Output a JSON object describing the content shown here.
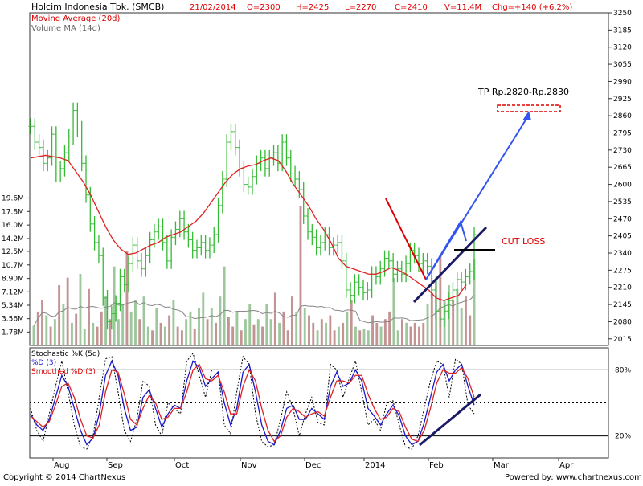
{
  "header": {
    "company": "Holcim Indonesia Tbk. (SMCB)",
    "date": "21/02/2014",
    "open": "O=2300",
    "high": "H=2425",
    "low": "L=2270",
    "close": "C=2410",
    "volume": "V=11.4M",
    "change": "Chg=+140 (+6.2%)"
  },
  "legend": {
    "ma20": "Moving Average (20d)",
    "volma": "Volume MA (14d)",
    "stoch_title": "Stochastic %K (5d)",
    "stoch_d": "%D (3)",
    "stoch_sd": "Smoothed %D (3)"
  },
  "annotations": {
    "tp": "TP Rp.2820-Rp.2830",
    "cutloss": "CUT LOSS"
  },
  "footer": {
    "copyright": "Copyright © 2014 ChartNexus",
    "powered": "Powered by: www.chartnexus.com"
  },
  "colors": {
    "background": "#ffffff",
    "price_bar": "#33bb33",
    "moving_average": "#dd2222",
    "volume_up": "#9ec79e",
    "volume_down": "#c49494",
    "volume_ma": "#888888",
    "stoch_k": "#000000",
    "stoch_d": "#1a1acc",
    "stoch_sd": "#dd2222",
    "trend_line": "#1a1a66",
    "cut_loss_line": "#000000",
    "annotation_red": "#dd0000",
    "annotation_blue": "#3355ee"
  },
  "chart_data": {
    "type": "line",
    "price": {
      "ylim": [
        1990,
        3250
      ],
      "y_ticks": [
        2015,
        2080,
        2145,
        2210,
        2275,
        2340,
        2405,
        2470,
        2535,
        2600,
        2665,
        2730,
        2795,
        2860,
        2925,
        2990,
        3055,
        3120,
        3185,
        3250
      ],
      "close": [
        2820,
        2760,
        2740,
        2680,
        2700,
        2790,
        2640,
        2660,
        2720,
        2780,
        2880,
        2810,
        2680,
        2560,
        2450,
        2380,
        2330,
        2170,
        2080,
        2110,
        2150,
        2250,
        2220,
        2300,
        2370,
        2310,
        2280,
        2330,
        2390,
        2420,
        2440,
        2380,
        2310,
        2400,
        2430,
        2470,
        2420,
        2390,
        2350,
        2360,
        2380,
        2350,
        2370,
        2410,
        2520,
        2620,
        2760,
        2800,
        2740,
        2660,
        2600,
        2590,
        2630,
        2680,
        2700,
        2660,
        2700,
        2720,
        2680,
        2760,
        2700,
        2640,
        2620,
        2580,
        2480,
        2420,
        2400,
        2360,
        2380,
        2410,
        2360,
        2370,
        2380,
        2310,
        2200,
        2180,
        2230,
        2210,
        2190,
        2200,
        2260,
        2250,
        2280,
        2320,
        2310,
        2260,
        2280,
        2260,
        2300,
        2350,
        2330,
        2300,
        2310,
        2290,
        2200,
        2120,
        2090,
        2120,
        2160,
        2200,
        2240,
        2230,
        2250,
        2270,
        2410
      ],
      "ma20": [
        2700,
        2705,
        2710,
        2705,
        2700,
        2690,
        2650,
        2610,
        2560,
        2500,
        2440,
        2390,
        2355,
        2335,
        2340,
        2355,
        2370,
        2380,
        2400,
        2410,
        2420,
        2440,
        2460,
        2490,
        2530,
        2570,
        2610,
        2640,
        2660,
        2670,
        2675,
        2690,
        2700,
        2690,
        2650,
        2600,
        2560,
        2520,
        2470,
        2430,
        2380,
        2320,
        2290,
        2280,
        2270,
        2260,
        2260,
        2270,
        2285,
        2275,
        2260,
        2240,
        2220,
        2200,
        2170,
        2160,
        2170,
        2180,
        2220
      ],
      "ma20_x_start_index": 0
    },
    "volume": {
      "y_ticks": [
        "1.78M",
        "3.56M",
        "5.34M",
        "7.12M",
        "8.90M",
        "10.7M",
        "12.5M",
        "14.2M",
        "16.0M",
        "17.8M",
        "19.6M"
      ],
      "ylim_m": [
        0,
        20.5
      ],
      "values_m": [
        2.6,
        4.5,
        6.0,
        4.0,
        2.5,
        3.5,
        8.0,
        5.5,
        9.0,
        3.0,
        4.2,
        9.5,
        2.2,
        7.5,
        3.0,
        2.5,
        4.5,
        6.5,
        3.5,
        10.5,
        3.5,
        5.5,
        12.5,
        4.5,
        6.0,
        3.5,
        6.5,
        2.5,
        2.0,
        5.0,
        3.0,
        2.5,
        4.0,
        6.0,
        2.5,
        2.0,
        3.5,
        4.5,
        2.2,
        5.0,
        7.0,
        3.5,
        5.0,
        3.0,
        6.5,
        10.5,
        3.8,
        2.5,
        4.5,
        2.0,
        3.5,
        5.5,
        2.8,
        3.5,
        2.5,
        5.5,
        3.5,
        7.0,
        3.0,
        4.5,
        2.0,
        6.5,
        4.5,
        18.5,
        5.0,
        4.0,
        3.0,
        2.0,
        3.5,
        3.0,
        4.0,
        2.0,
        2.5,
        3.0,
        4.5,
        6.0,
        2.5,
        2.0,
        2.2,
        2.0,
        4.0,
        3.0,
        2.5,
        3.5,
        4.5,
        9.0,
        2.0,
        3.5,
        3.0,
        2.5,
        3.0,
        2.5,
        3.0,
        5.5,
        7.0,
        9.0,
        12.0,
        6.0,
        8.0,
        6.0,
        7.5,
        5.0,
        6.5,
        4.0,
        11.4
      ],
      "up": [
        true,
        false,
        false,
        true,
        false,
        true,
        false,
        true,
        false,
        true,
        false,
        true,
        true,
        false,
        true,
        false,
        false,
        true,
        false,
        true,
        true,
        true,
        false,
        true,
        true,
        false,
        true,
        true,
        false,
        true,
        false,
        true,
        false,
        true,
        false,
        false,
        true,
        true,
        false,
        true,
        true,
        false,
        true,
        false,
        true,
        true,
        false,
        false,
        true,
        false,
        true,
        true,
        false,
        true,
        false,
        true,
        true,
        false,
        true,
        false,
        false,
        false,
        true,
        false,
        true,
        false,
        false,
        true,
        false,
        true,
        false,
        false,
        true,
        false,
        true,
        false,
        true,
        false,
        true,
        true,
        false,
        false,
        true,
        false,
        false,
        true,
        true,
        false,
        true,
        false,
        false,
        false,
        false,
        true,
        false,
        true,
        false,
        true,
        true,
        false,
        true,
        true,
        false,
        false,
        true
      ]
    },
    "stochastic": {
      "ylim": [
        0,
        100
      ],
      "labels": [
        "80%",
        "20%"
      ],
      "levels": [
        80,
        20
      ],
      "k": [
        45,
        25,
        15,
        40,
        65,
        88,
        60,
        30,
        10,
        8,
        20,
        55,
        90,
        92,
        60,
        25,
        15,
        35,
        70,
        65,
        30,
        20,
        50,
        45,
        40,
        88,
        95,
        75,
        55,
        80,
        80,
        30,
        22,
        60,
        92,
        85,
        40,
        15,
        10,
        12,
        35,
        60,
        45,
        20,
        40,
        55,
        32,
        30,
        85,
        80,
        55,
        72,
        88,
        60,
        30,
        35,
        25,
        50,
        52,
        30,
        10,
        8,
        20,
        45,
        70,
        88,
        85,
        55,
        90,
        85,
        48,
        40
      ],
      "d": [
        40,
        30,
        25,
        35,
        55,
        75,
        65,
        45,
        25,
        12,
        18,
        40,
        75,
        88,
        75,
        45,
        25,
        28,
        55,
        62,
        45,
        28,
        40,
        48,
        45,
        70,
        88,
        82,
        65,
        72,
        78,
        50,
        30,
        45,
        78,
        85,
        60,
        30,
        15,
        12,
        25,
        45,
        48,
        35,
        35,
        45,
        40,
        35,
        65,
        78,
        65,
        68,
        80,
        70,
        45,
        38,
        30,
        40,
        48,
        38,
        20,
        12,
        15,
        32,
        55,
        78,
        85,
        70,
        80,
        85,
        65,
        48
      ],
      "sd": [
        38,
        33,
        28,
        33,
        48,
        65,
        68,
        55,
        35,
        20,
        18,
        30,
        60,
        80,
        78,
        58,
        35,
        30,
        45,
        57,
        50,
        35,
        37,
        45,
        45,
        60,
        80,
        85,
        72,
        70,
        75,
        60,
        40,
        40,
        65,
        80,
        70,
        45,
        25,
        15,
        20,
        37,
        45,
        42,
        37,
        40,
        42,
        38,
        55,
        70,
        70,
        68,
        75,
        75,
        58,
        45,
        35,
        37,
        45,
        42,
        28,
        17,
        15,
        25,
        45,
        68,
        80,
        77,
        77,
        82,
        72,
        55
      ]
    },
    "months": [
      "Aug",
      "Sep",
      "Oct",
      "Nov",
      "Dec",
      "2014",
      "Feb",
      "Mar",
      "Apr"
    ],
    "footer_label": ""
  }
}
